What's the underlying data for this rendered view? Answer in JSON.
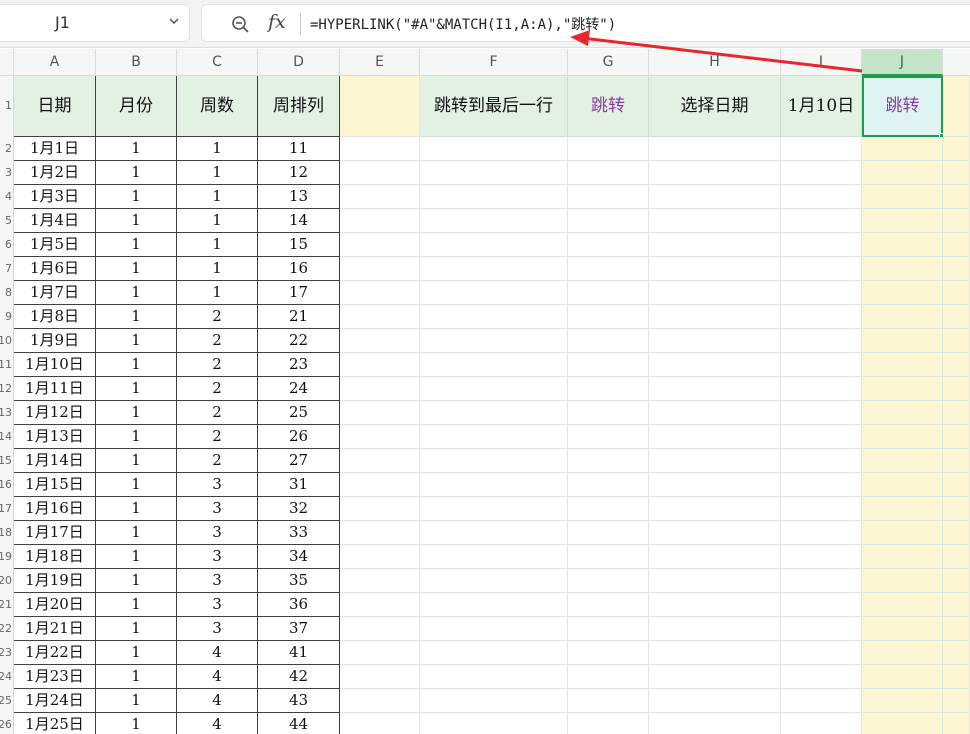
{
  "namebox": {
    "value": "J1"
  },
  "formula_bar": {
    "formula": "=HYPERLINK(\"#A\"&MATCH(I1,A:A),\"跳转\")"
  },
  "columns": [
    "A",
    "B",
    "C",
    "D",
    "E",
    "F",
    "G",
    "H",
    "I",
    "J"
  ],
  "selected_column": "J",
  "header_row": {
    "A": "日期",
    "B": "月份",
    "C": "周数",
    "D": "周排列",
    "E": "",
    "F": "跳转到最后一行",
    "G": "跳转",
    "H": "选择日期",
    "I": "1月10日",
    "J": "跳转"
  },
  "row_numbers": [
    "1",
    "2",
    "3",
    "4",
    "5",
    "6",
    "7",
    "8",
    "9",
    "10",
    "11",
    "12",
    "13",
    "14",
    "15",
    "16",
    "17",
    "18",
    "19",
    "20",
    "21",
    "22",
    "23",
    "24",
    "25",
    "26"
  ],
  "rows": [
    {
      "date": "1月1日",
      "month": "1",
      "week": "1",
      "order": "11"
    },
    {
      "date": "1月2日",
      "month": "1",
      "week": "1",
      "order": "12"
    },
    {
      "date": "1月3日",
      "month": "1",
      "week": "1",
      "order": "13"
    },
    {
      "date": "1月4日",
      "month": "1",
      "week": "1",
      "order": "14"
    },
    {
      "date": "1月5日",
      "month": "1",
      "week": "1",
      "order": "15"
    },
    {
      "date": "1月6日",
      "month": "1",
      "week": "1",
      "order": "16"
    },
    {
      "date": "1月7日",
      "month": "1",
      "week": "1",
      "order": "17"
    },
    {
      "date": "1月8日",
      "month": "1",
      "week": "2",
      "order": "21"
    },
    {
      "date": "1月9日",
      "month": "1",
      "week": "2",
      "order": "22"
    },
    {
      "date": "1月10日",
      "month": "1",
      "week": "2",
      "order": "23"
    },
    {
      "date": "1月11日",
      "month": "1",
      "week": "2",
      "order": "24"
    },
    {
      "date": "1月12日",
      "month": "1",
      "week": "2",
      "order": "25"
    },
    {
      "date": "1月13日",
      "month": "1",
      "week": "2",
      "order": "26"
    },
    {
      "date": "1月14日",
      "month": "1",
      "week": "2",
      "order": "27"
    },
    {
      "date": "1月15日",
      "month": "1",
      "week": "3",
      "order": "31"
    },
    {
      "date": "1月16日",
      "month": "1",
      "week": "3",
      "order": "32"
    },
    {
      "date": "1月17日",
      "month": "1",
      "week": "3",
      "order": "33"
    },
    {
      "date": "1月18日",
      "month": "1",
      "week": "3",
      "order": "34"
    },
    {
      "date": "1月19日",
      "month": "1",
      "week": "3",
      "order": "35"
    },
    {
      "date": "1月20日",
      "month": "1",
      "week": "3",
      "order": "36"
    },
    {
      "date": "1月21日",
      "month": "1",
      "week": "3",
      "order": "37"
    },
    {
      "date": "1月22日",
      "month": "1",
      "week": "4",
      "order": "41"
    },
    {
      "date": "1月23日",
      "month": "1",
      "week": "4",
      "order": "42"
    },
    {
      "date": "1月24日",
      "month": "1",
      "week": "4",
      "order": "43"
    },
    {
      "date": "1月25日",
      "month": "1",
      "week": "4",
      "order": "44"
    }
  ],
  "colors": {
    "header_fill": "#e3f1e3",
    "yellow_fill": "#fdf6d2",
    "selection": "#1e9e4a",
    "link_text": "#8a3aa0",
    "arrow": "#e8262b"
  },
  "icons": {
    "namebox_dropdown": "chevron-down-icon",
    "zoom": "zoom-icon",
    "function": "fx-icon"
  }
}
